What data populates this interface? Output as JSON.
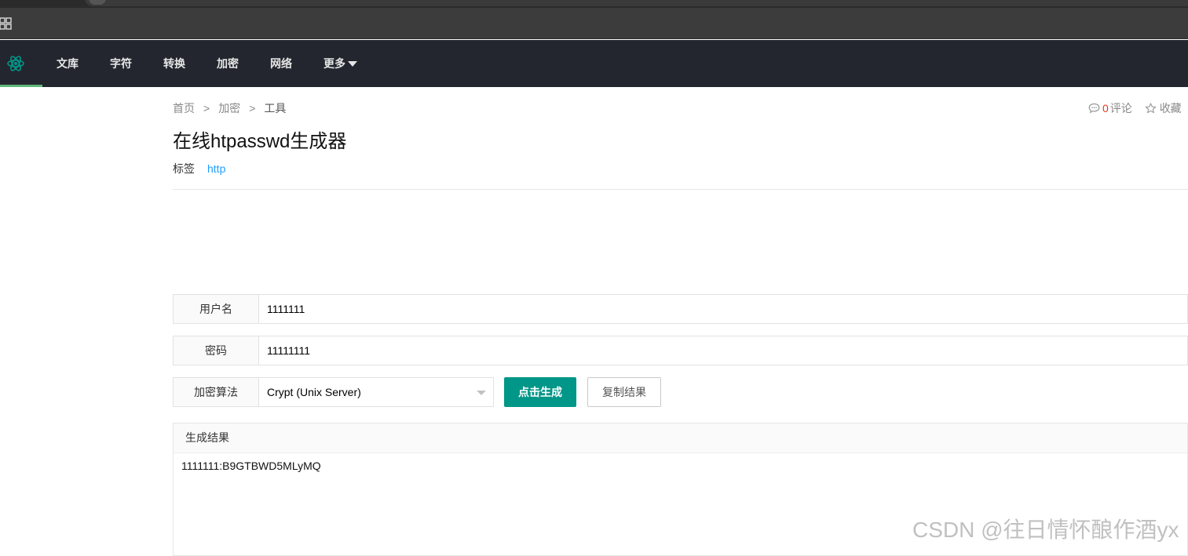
{
  "nav": {
    "items": [
      {
        "label": "文库"
      },
      {
        "label": "字符"
      },
      {
        "label": "转换"
      },
      {
        "label": "加密"
      },
      {
        "label": "网络"
      },
      {
        "label": "更多"
      }
    ]
  },
  "breadcrumb": {
    "items": [
      "首页",
      "加密",
      "工具"
    ],
    "separator": ">"
  },
  "actions": {
    "comment_count": "0",
    "comment_label": "评论",
    "favorite_label": "收藏"
  },
  "page": {
    "title": "在线htpasswd生成器",
    "tags_label": "标签",
    "tags": [
      "http"
    ]
  },
  "form": {
    "username_label": "用户名",
    "username_value": "1111111",
    "password_label": "密码",
    "password_value": "11111111",
    "algorithm_label": "加密算法",
    "algorithm_value": "Crypt (Unix Server)",
    "generate_button": "点击生成",
    "copy_button": "复制结果"
  },
  "result": {
    "header": "生成结果",
    "value": "1111111:B9GTBWD5MLyMQ"
  },
  "watermark": "CSDN @往日情怀酿作酒yx",
  "colors": {
    "nav_bg": "#23262e",
    "accent_green": "#009688",
    "tag_link": "#1e9fff",
    "comment_count": "#e03a1f"
  }
}
